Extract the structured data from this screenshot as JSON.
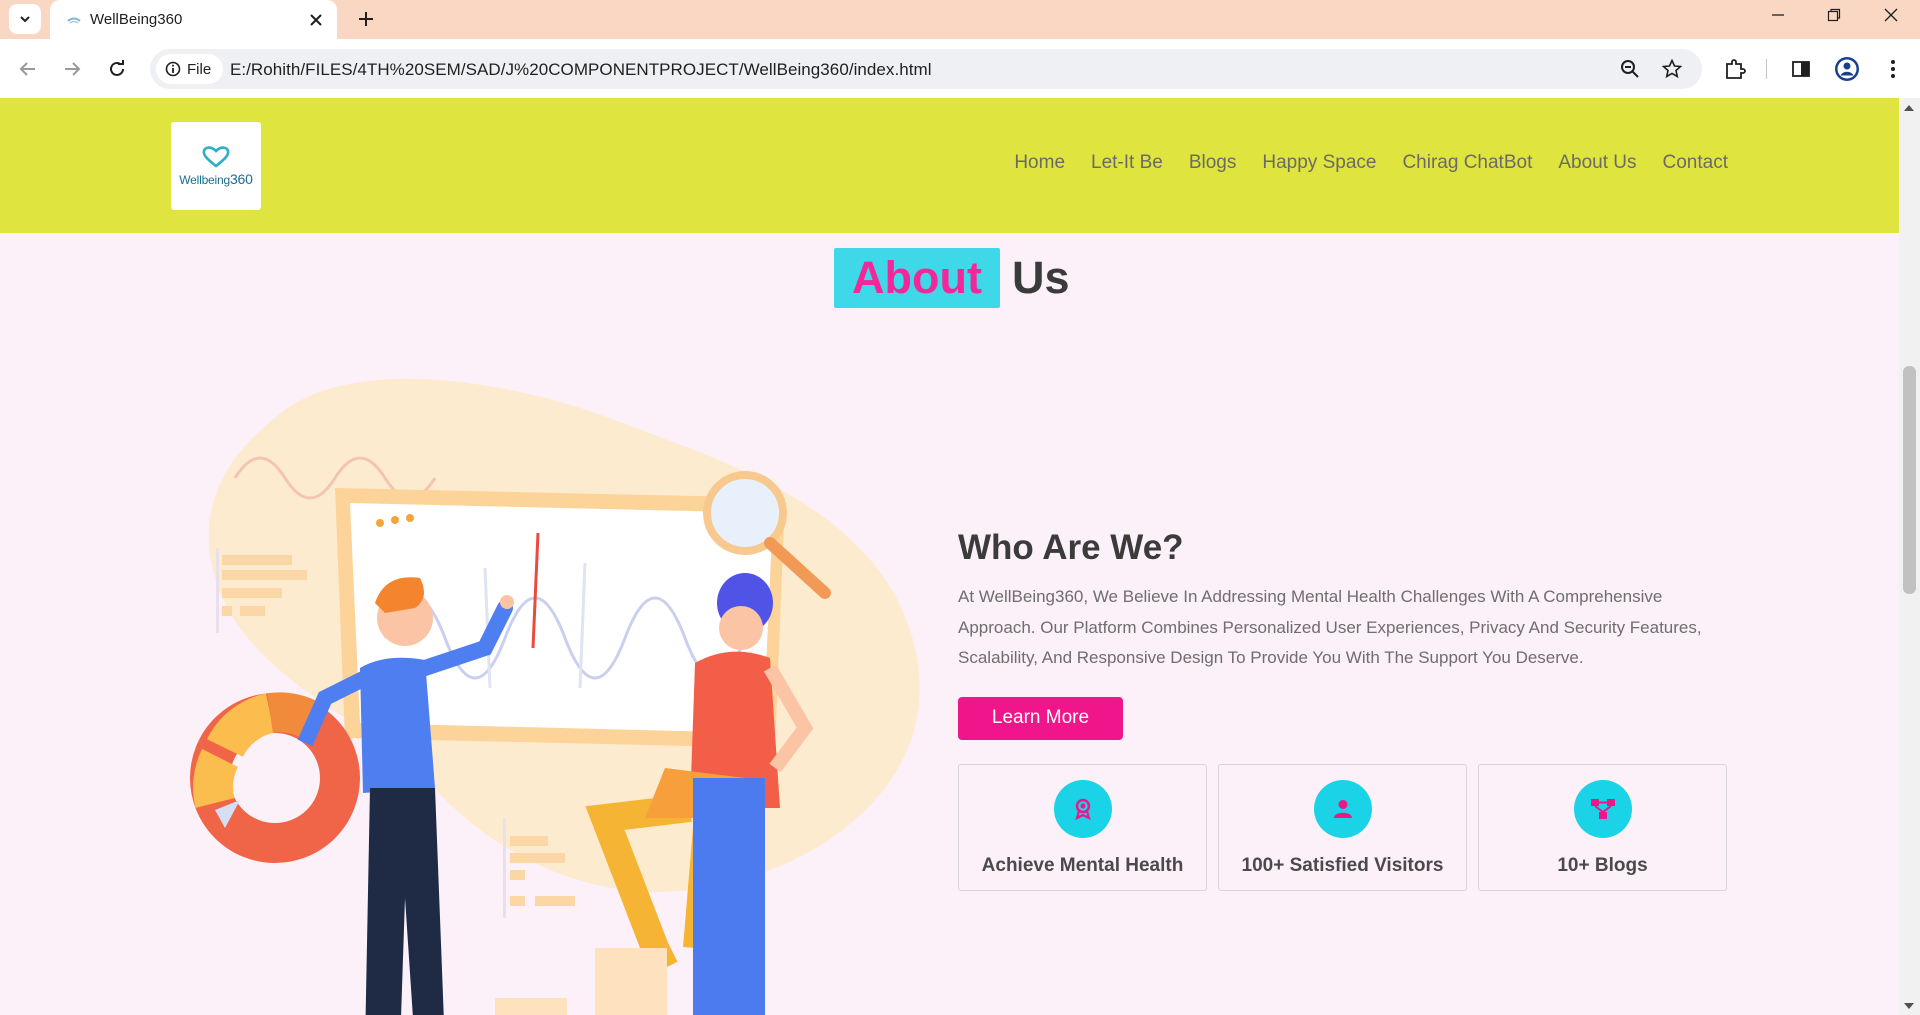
{
  "browser": {
    "tab_title": "WellBeing360",
    "site_chip_label": "File",
    "url": "E:/Rohith/FILES/4TH%20SEM/SAD/J%20COMPONENTPROJECT/WellBeing360/index.html"
  },
  "site": {
    "logo_text_main": "Wellbeing",
    "logo_text_num": "360",
    "nav": [
      "Home",
      "Let-It Be",
      "Blogs",
      "Happy Space",
      "Chirag ChatBot",
      "About Us",
      "Contact"
    ]
  },
  "about": {
    "heading_highlight": "About",
    "heading_rest": "Us",
    "title": "Who Are We?",
    "text": "At WellBeing360, We Believe In Addressing Mental Health Challenges With A Comprehensive Approach. Our Platform Combines Personalized User Experiences, Privacy And Security Features, Scalability, And Responsive Design To Provide You With The Support You Deserve.",
    "button_label": "Learn More",
    "stats": [
      {
        "label": "Achieve Mental Health",
        "icon": "award-icon"
      },
      {
        "label": "100+ Satisfied Visitors",
        "icon": "user-icon"
      },
      {
        "label": "10+ Blogs",
        "icon": "network-icon"
      }
    ]
  },
  "colors": {
    "header_bg": "#e0e43e",
    "page_bg": "#fcf0f9",
    "accent_pink": "#f0158a",
    "accent_cyan": "#1ad3e6",
    "tabbar_bg": "#fad7c3"
  }
}
